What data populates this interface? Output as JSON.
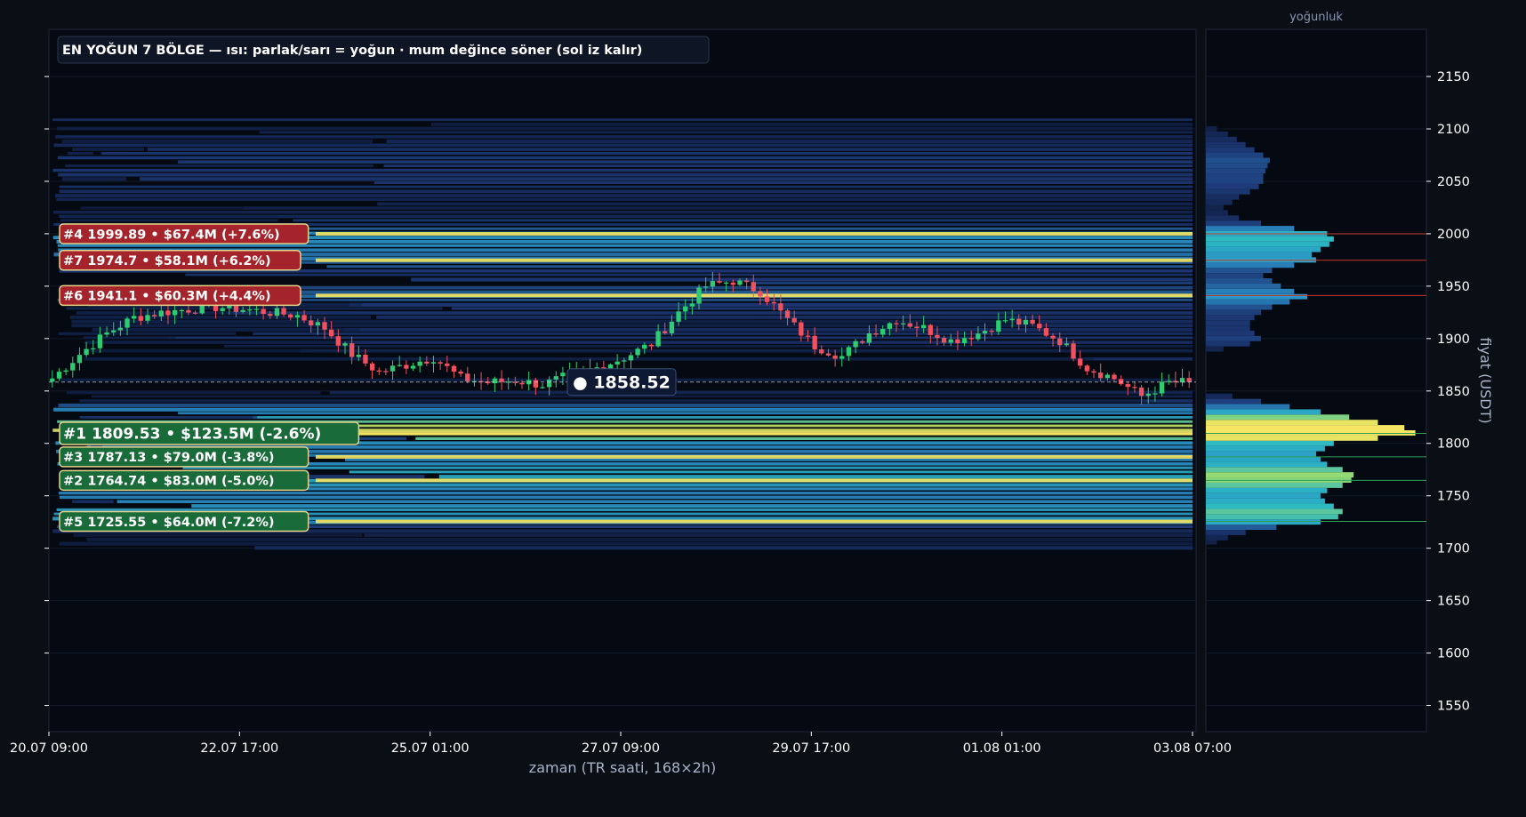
{
  "chart_data": {
    "type": "heatmap",
    "title": "EN YOĞUN 7 BÖLGE — ısı: parlak/sarı = yoğun · mum değince söner (sol iz kalır)",
    "xlabel": "zaman (TR saati, 168×2h)",
    "ylabel": "fiyat (USDT)",
    "side_panel_title": "yoğunluk",
    "ylim": [
      1525,
      2195
    ],
    "y_ticks": [
      1550,
      1600,
      1650,
      1700,
      1750,
      1800,
      1850,
      1900,
      1950,
      2000,
      2050,
      2100,
      2150
    ],
    "x_ticks": [
      "20.07 09:00",
      "22.07 17:00",
      "25.07 01:00",
      "27.07 09:00",
      "29.07 17:00",
      "01.08 01:00",
      "03.08 07:00"
    ],
    "candle_count": 168,
    "current_price": 1858.52,
    "current_price_label": "● 1858.52",
    "price_path": [
      [
        0,
        1862
      ],
      [
        4,
        1885
      ],
      [
        8,
        1905
      ],
      [
        12,
        1920
      ],
      [
        16,
        1925
      ],
      [
        20,
        1928
      ],
      [
        24,
        1930
      ],
      [
        28,
        1928
      ],
      [
        32,
        1925
      ],
      [
        36,
        1922
      ],
      [
        40,
        1910
      ],
      [
        44,
        1885
      ],
      [
        48,
        1868
      ],
      [
        52,
        1875
      ],
      [
        56,
        1882
      ],
      [
        60,
        1862
      ],
      [
        64,
        1858
      ],
      [
        68,
        1860
      ],
      [
        72,
        1856
      ],
      [
        76,
        1865
      ],
      [
        80,
        1872
      ],
      [
        84,
        1882
      ],
      [
        88,
        1895
      ],
      [
        92,
        1925
      ],
      [
        96,
        1950
      ],
      [
        100,
        1955
      ],
      [
        104,
        1945
      ],
      [
        108,
        1918
      ],
      [
        112,
        1893
      ],
      [
        116,
        1883
      ],
      [
        120,
        1905
      ],
      [
        124,
        1918
      ],
      [
        128,
        1910
      ],
      [
        132,
        1898
      ],
      [
        136,
        1905
      ],
      [
        140,
        1918
      ],
      [
        144,
        1912
      ],
      [
        148,
        1898
      ],
      [
        152,
        1872
      ],
      [
        156,
        1862
      ],
      [
        160,
        1845
      ],
      [
        164,
        1858
      ],
      [
        167,
        1858.52
      ]
    ],
    "zones": [
      {
        "rank": 1,
        "label": "#1  1809.53  •  $123.5M  (-2.6%)",
        "price": 1809.53,
        "volume": "$123.5M",
        "change": "-2.6%",
        "side": "support"
      },
      {
        "rank": 2,
        "label": "#2  1764.74  •  $83.0M  (-5.0%)",
        "price": 1764.74,
        "volume": "$83.0M",
        "change": "-5.0%",
        "side": "support"
      },
      {
        "rank": 3,
        "label": "#3  1787.13  •  $79.0M  (-3.8%)",
        "price": 1787.13,
        "volume": "$79.0M",
        "change": "-3.8%",
        "side": "support"
      },
      {
        "rank": 4,
        "label": "#4  1999.89  •  $67.4M  (+7.6%)",
        "price": 1999.89,
        "volume": "$67.4M",
        "change": "+7.6%",
        "side": "resistance"
      },
      {
        "rank": 5,
        "label": "#5  1725.55  •  $64.0M  (-7.2%)",
        "price": 1725.55,
        "volume": "$64.0M",
        "change": "-7.2%",
        "side": "support"
      },
      {
        "rank": 6,
        "label": "#6  1941.1  •  $60.3M  (+4.4%)",
        "price": 1941.1,
        "volume": "$60.3M",
        "change": "+4.4%",
        "side": "resistance"
      },
      {
        "rank": 7,
        "label": "#7  1974.7  •  $58.1M  (+6.2%)",
        "price": 1974.7,
        "volume": "$58.1M",
        "change": "+6.2%",
        "side": "resistance"
      }
    ],
    "density_profile": [
      [
        1706,
        0.05
      ],
      [
        1710,
        0.1
      ],
      [
        1715,
        0.18
      ],
      [
        1720,
        0.32
      ],
      [
        1725,
        0.52
      ],
      [
        1730,
        0.6
      ],
      [
        1735,
        0.62
      ],
      [
        1740,
        0.58
      ],
      [
        1745,
        0.54
      ],
      [
        1750,
        0.52
      ],
      [
        1755,
        0.55
      ],
      [
        1760,
        0.62
      ],
      [
        1765,
        0.66
      ],
      [
        1770,
        0.67
      ],
      [
        1775,
        0.62
      ],
      [
        1780,
        0.55
      ],
      [
        1785,
        0.52
      ],
      [
        1790,
        0.5
      ],
      [
        1795,
        0.54
      ],
      [
        1800,
        0.58
      ],
      [
        1805,
        0.78
      ],
      [
        1810,
        0.95
      ],
      [
        1815,
        0.9
      ],
      [
        1820,
        0.78
      ],
      [
        1825,
        0.65
      ],
      [
        1830,
        0.52
      ],
      [
        1835,
        0.38
      ],
      [
        1840,
        0.25
      ],
      [
        1845,
        0.12
      ],
      [
        1890,
        0.08
      ],
      [
        1895,
        0.2
      ],
      [
        1900,
        0.25
      ],
      [
        1905,
        0.22
      ],
      [
        1910,
        0.2
      ],
      [
        1915,
        0.2
      ],
      [
        1920,
        0.22
      ],
      [
        1925,
        0.25
      ],
      [
        1930,
        0.3
      ],
      [
        1935,
        0.38
      ],
      [
        1940,
        0.46
      ],
      [
        1945,
        0.4
      ],
      [
        1950,
        0.34
      ],
      [
        1955,
        0.3
      ],
      [
        1960,
        0.26
      ],
      [
        1965,
        0.3
      ],
      [
        1970,
        0.4
      ],
      [
        1975,
        0.5
      ],
      [
        1980,
        0.48
      ],
      [
        1985,
        0.52
      ],
      [
        1990,
        0.56
      ],
      [
        1995,
        0.58
      ],
      [
        2000,
        0.55
      ],
      [
        2005,
        0.4
      ],
      [
        2010,
        0.25
      ],
      [
        2015,
        0.15
      ],
      [
        2020,
        0.1
      ],
      [
        2025,
        0.08
      ],
      [
        2030,
        0.12
      ],
      [
        2035,
        0.15
      ],
      [
        2040,
        0.2
      ],
      [
        2045,
        0.24
      ],
      [
        2050,
        0.26
      ],
      [
        2055,
        0.26
      ],
      [
        2060,
        0.27
      ],
      [
        2065,
        0.28
      ],
      [
        2070,
        0.29
      ],
      [
        2075,
        0.26
      ],
      [
        2080,
        0.22
      ],
      [
        2085,
        0.18
      ],
      [
        2090,
        0.14
      ],
      [
        2095,
        0.1
      ],
      [
        2100,
        0.05
      ]
    ],
    "colors": {
      "background": "#0a0e15",
      "plot_bg": "#050a12",
      "up_candle": "#2ecc71",
      "down_candle": "#f0515f",
      "resistance_box": "#a5242b",
      "support_box": "#1a6b3a",
      "heat_low": "#1e3a78",
      "heat_mid": "#2bb0c8",
      "heat_high": "#f5e663"
    }
  }
}
